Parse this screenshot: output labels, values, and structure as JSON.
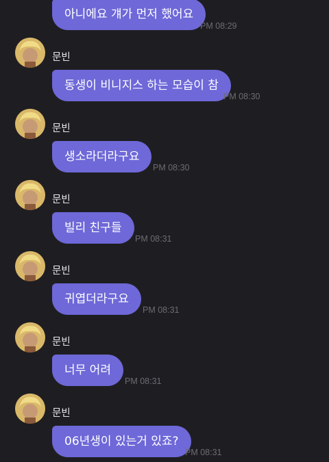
{
  "messages": [
    {
      "sender": "",
      "text": "아니에요 걔가 먼저 했어요",
      "time": "PM 08:29"
    },
    {
      "sender": "문빈",
      "text": "동생이 비니지스 하는 모습이 참",
      "time": "PM 08:30"
    },
    {
      "sender": "문빈",
      "text": "생소라더라구요",
      "time": "PM 08:30"
    },
    {
      "sender": "문빈",
      "text": "빌리 친구들",
      "time": "PM 08:31"
    },
    {
      "sender": "문빈",
      "text": "귀엽더라구요",
      "time": "PM 08:31"
    },
    {
      "sender": "문빈",
      "text": "너무 어려",
      "time": "PM 08:31"
    },
    {
      "sender": "문빈",
      "text": "06년생이 있는거 있죠?",
      "time": "PM 08:31"
    }
  ],
  "colors": {
    "background": "#1e1e22",
    "bubble": "#6e68d8",
    "bubble_text": "#ffffff",
    "timestamp": "#6b6b72",
    "name": "#e6e6ea"
  },
  "icons": {
    "avatar": "profile-avatar-icon"
  }
}
